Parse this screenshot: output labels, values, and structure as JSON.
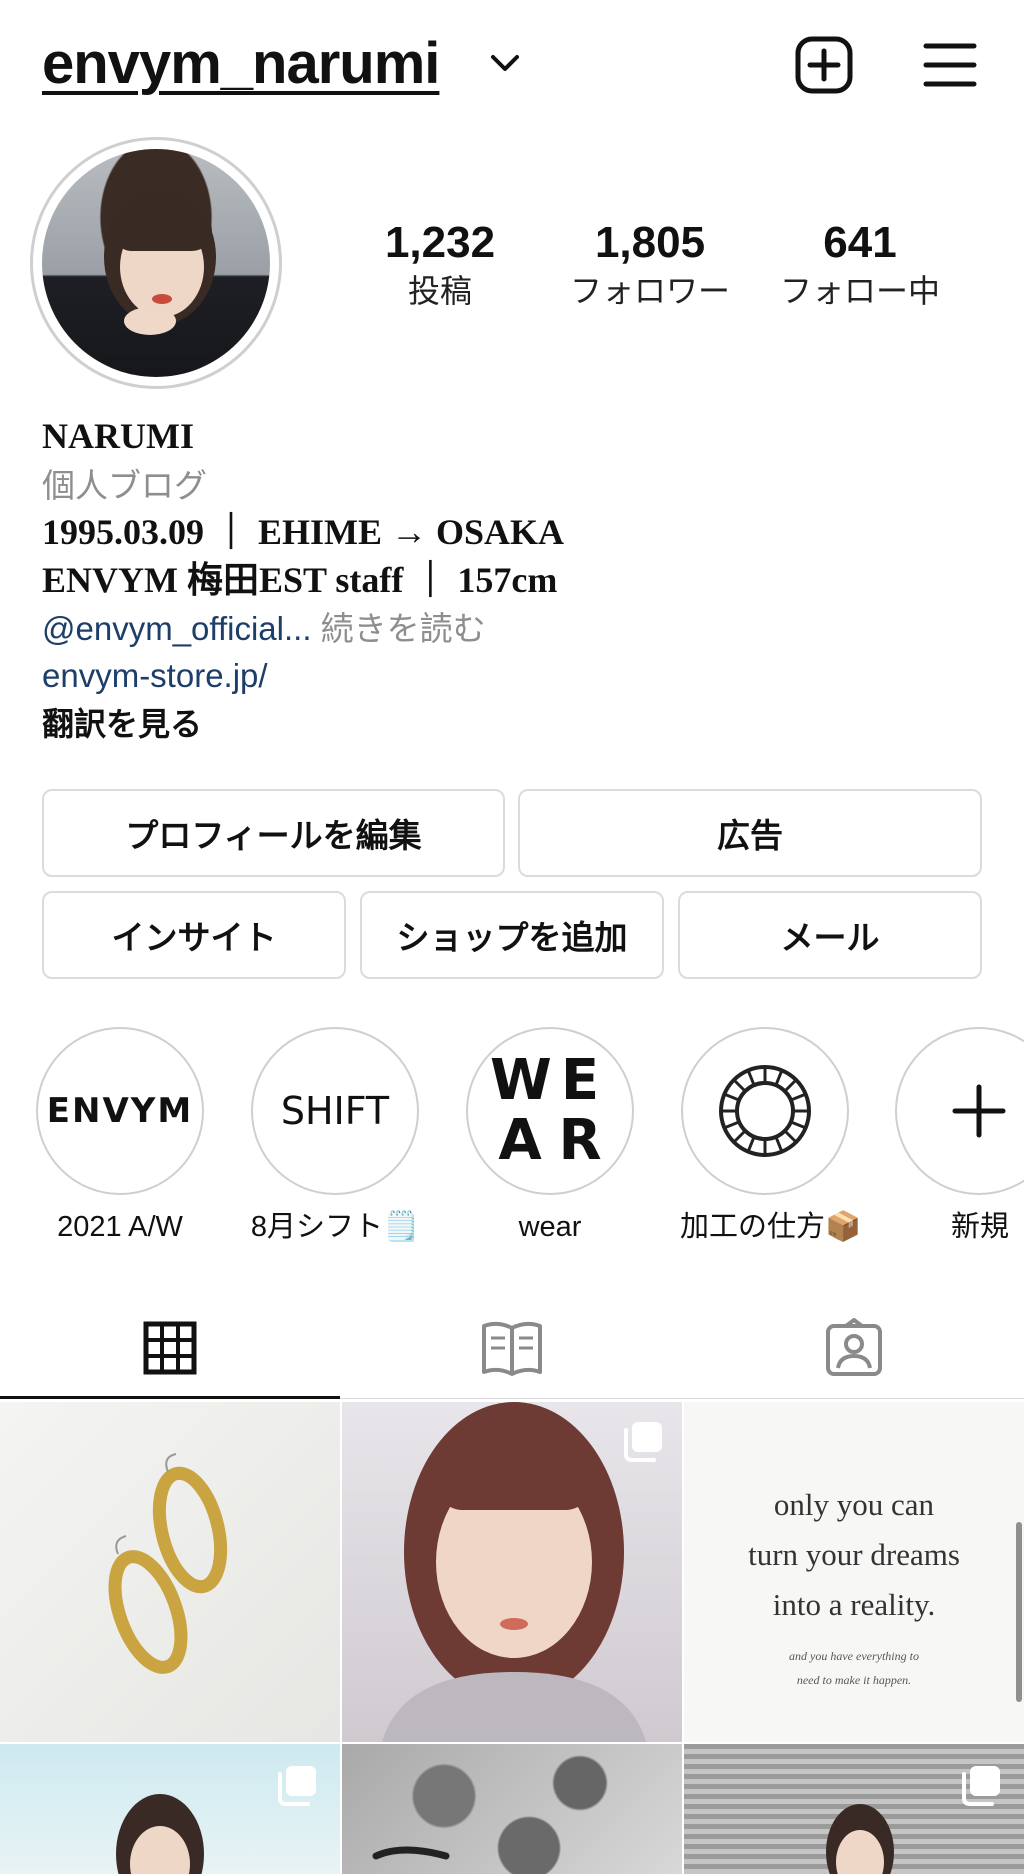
{
  "header": {
    "username": "envym_narumi"
  },
  "stats": [
    {
      "value": "1,232",
      "label": "投稿"
    },
    {
      "value": "1,805",
      "label": "フォロワー"
    },
    {
      "value": "641",
      "label": "フォロー中"
    }
  ],
  "bio": {
    "name": "NARUMI",
    "category": "個人ブログ",
    "line1": "1995.03.09 ｜ EHIME → OSAKA",
    "line2": "ENVYM 梅田EST staff ｜ 157cm",
    "mention": "@envym_official...",
    "read_more": "続きを読む",
    "url": "envym-store.jp/",
    "translate": "翻訳を見る"
  },
  "buttons": {
    "edit_profile": "プロフィールを編集",
    "ads": "広告",
    "insights": "インサイト",
    "add_shop": "ショップを追加",
    "email": "メール"
  },
  "highlights": [
    {
      "cover_text": "ENVYM",
      "label": "2021 A/W"
    },
    {
      "cover_text": "SHIFT",
      "label": "8月シフト🗒️"
    },
    {
      "cover_letters": [
        "W",
        "E",
        "A",
        "R"
      ],
      "label": "wear"
    },
    {
      "cover_icon": "ring-icon",
      "label": "加工の仕方📦"
    },
    {
      "cover_icon": "plus-icon",
      "label": "新規"
    }
  ],
  "tabs": [
    {
      "icon": "grid-icon",
      "active": true
    },
    {
      "icon": "guide-icon",
      "active": false
    },
    {
      "icon": "tagged-icon",
      "active": false
    }
  ],
  "quote_post": {
    "lines": [
      "only you can",
      "turn your dreams",
      "into a reality."
    ],
    "small_lines": [
      "and you have everything to",
      "need to make it happen."
    ]
  }
}
